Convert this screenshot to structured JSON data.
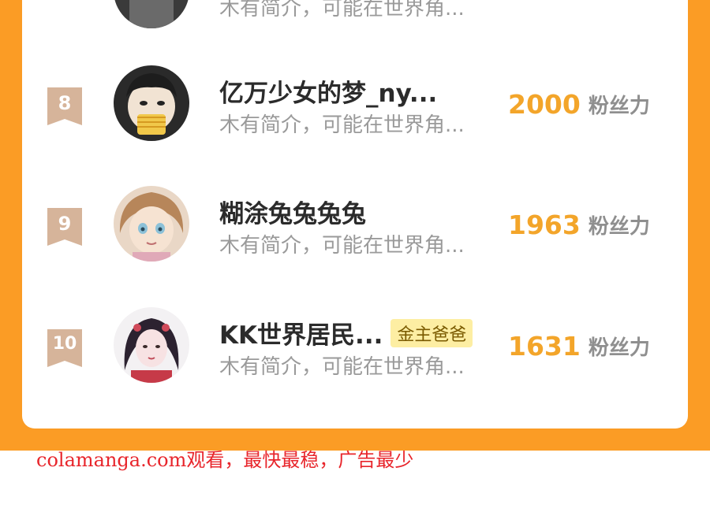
{
  "colors": {
    "orange_background": "#fb9c25",
    "score_orange": "#f3a52a",
    "badge_tan": "#d6b49a",
    "tag_yellow": "#fdeea3",
    "watermark_red": "#e8252b"
  },
  "ranking": {
    "top_partial_row": {
      "avatar_icon": "avatar-partial",
      "bio": "木有简介，可能在世界角..."
    },
    "rows": [
      {
        "rank": "8",
        "avatar_icon": "avatar-boy-eating-fries",
        "name": "亿万少女的梦_ny...",
        "tag": "",
        "bio": "木有简介，可能在世界角...",
        "score": "2000",
        "score_unit": "粉丝力"
      },
      {
        "rank": "9",
        "avatar_icon": "avatar-anime-girl",
        "name": "糊涂兔兔兔兔",
        "tag": "",
        "bio": "木有简介，可能在世界角...",
        "score": "1963",
        "score_unit": "粉丝力"
      },
      {
        "rank": "10",
        "avatar_icon": "avatar-costume-girl",
        "name": "KK世界居民...",
        "tag": "金主爸爸",
        "bio": "木有简介，可能在世界角...",
        "score": "1631",
        "score_unit": "粉丝力"
      }
    ]
  },
  "watermark": "colamanga.com观看，最快最稳，广告最少"
}
